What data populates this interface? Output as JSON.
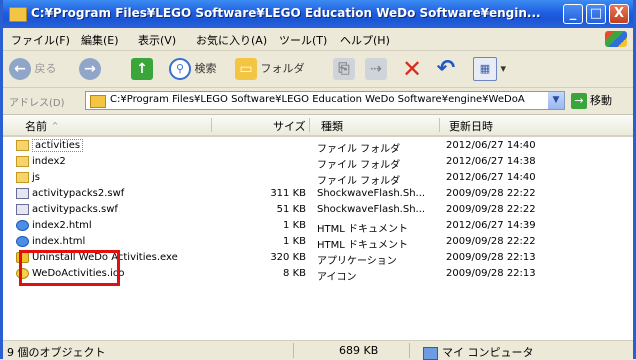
{
  "window": {
    "title": "C:¥Program Files¥LEGO Software¥LEGO Education WeDo Software¥engin...",
    "minimize_label": "_",
    "maximize_label": "□",
    "close_label": "X"
  },
  "menu": [
    "ファイル(F)",
    "編集(E)",
    "表示(V)",
    "お気に入り(A)",
    "ツール(T)",
    "ヘルプ(H)"
  ],
  "toolbar": {
    "back_label": "戻る",
    "search_label": "検索",
    "folders_label": "フォルダ"
  },
  "address": {
    "label": "アドレス(D)",
    "value": "C:¥Program Files¥LEGO Software¥LEGO Education WeDo Software¥engine¥WeDoA",
    "go_label": "移動"
  },
  "columns": {
    "name": "名前",
    "size": "サイズ",
    "type": "種類",
    "date": "更新日時"
  },
  "files": [
    {
      "icon": "folder",
      "name": "activities",
      "size": "",
      "type": "ファイル フォルダ",
      "date": "2012/06/27 14:40"
    },
    {
      "icon": "folder",
      "name": "index2",
      "size": "",
      "type": "ファイル フォルダ",
      "date": "2012/06/27 14:38"
    },
    {
      "icon": "folder",
      "name": "js",
      "size": "",
      "type": "ファイル フォルダ",
      "date": "2012/06/27 14:40"
    },
    {
      "icon": "swf",
      "name": "activitypacks2.swf",
      "size": "311 KB",
      "type": "ShockwaveFlash.Sh...",
      "date": "2009/09/28 22:22"
    },
    {
      "icon": "swf",
      "name": "activitypacks.swf",
      "size": "51 KB",
      "type": "ShockwaveFlash.Sh...",
      "date": "2009/09/28 22:22"
    },
    {
      "icon": "html",
      "name": "index2.html",
      "size": "1 KB",
      "type": "HTML ドキュメント",
      "date": "2012/06/27 14:39"
    },
    {
      "icon": "html",
      "name": "index.html",
      "size": "1 KB",
      "type": "HTML ドキュメント",
      "date": "2009/09/28 22:22"
    },
    {
      "icon": "exe",
      "name": "Uninstall WeDo Activities.exe",
      "size": "320 KB",
      "type": "アプリケーション",
      "date": "2009/09/28 22:13"
    },
    {
      "icon": "ico",
      "name": "WeDoActivities.ico",
      "size": "8 KB",
      "type": "アイコン",
      "date": "2009/09/28 22:13"
    }
  ],
  "status": {
    "objects": "9 個のオブジェクト",
    "size": "689 KB",
    "location": "マイ コンピュータ"
  },
  "colors": {
    "titlebar": "#1f5fe0",
    "highlight_box": "#e01010",
    "chrome": "#ece9d8"
  }
}
